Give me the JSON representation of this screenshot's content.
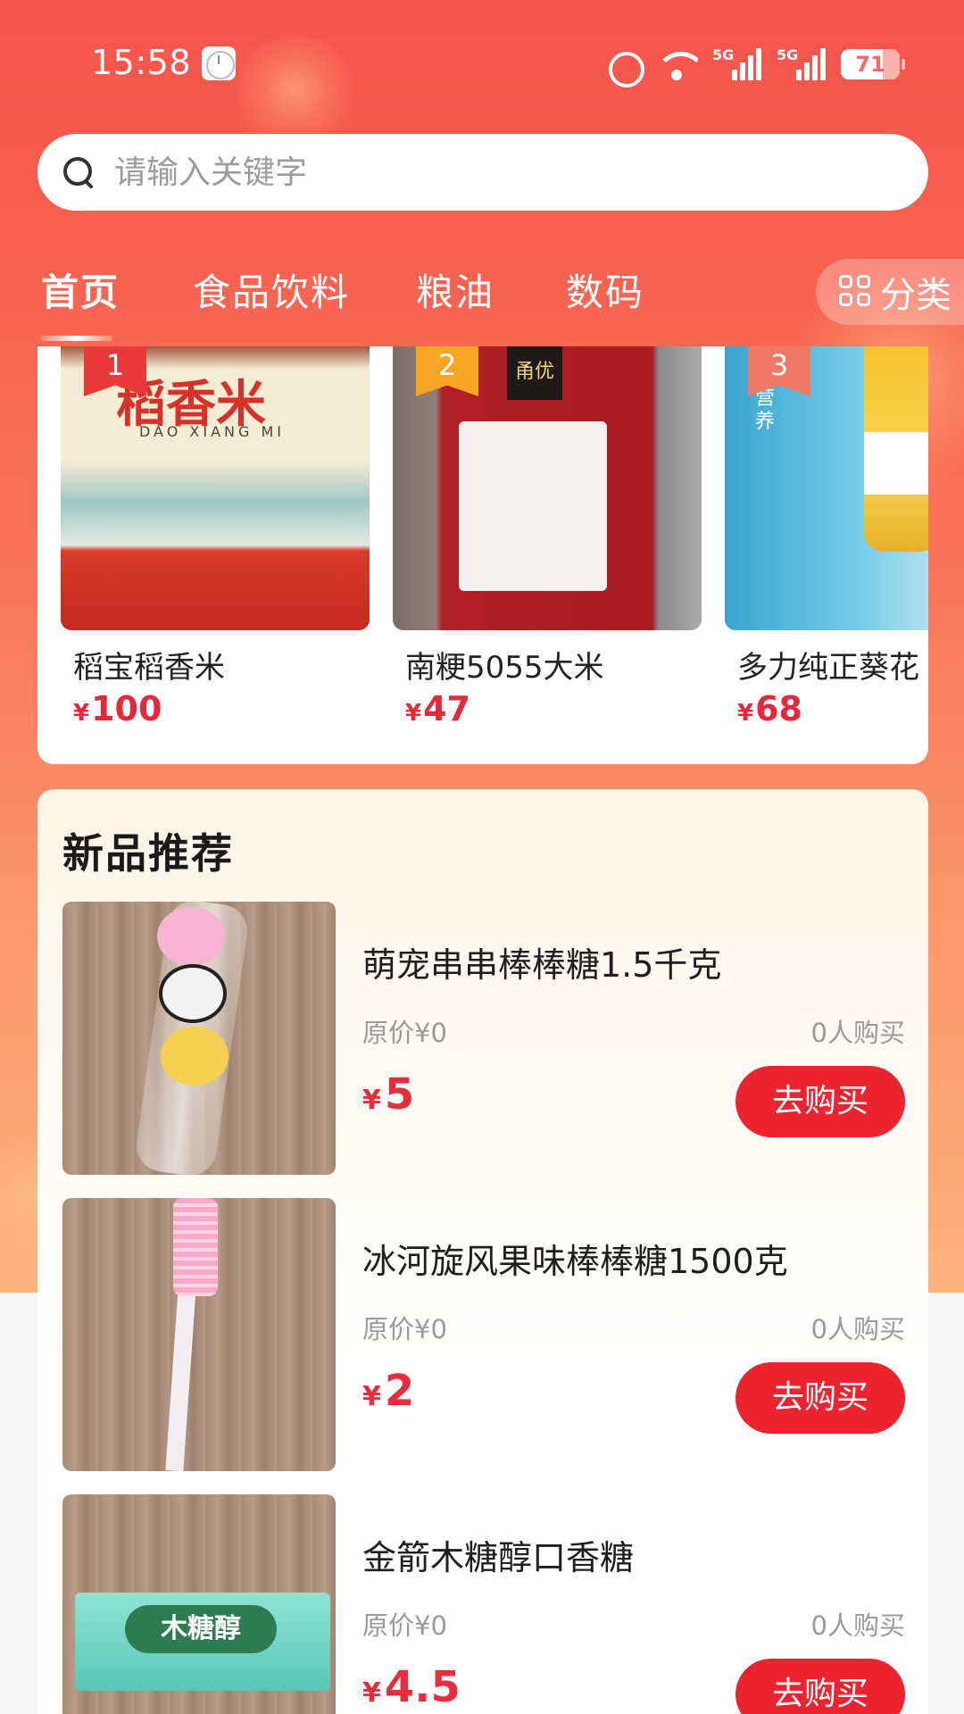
{
  "status_bar": {
    "time": "15:58",
    "battery": "71",
    "battery_level": 0.71,
    "network": [
      "5G",
      "5G"
    ]
  },
  "search": {
    "placeholder": "请输入关键字"
  },
  "tabs": [
    {
      "label": "首页",
      "active": true
    },
    {
      "label": "食品饮料"
    },
    {
      "label": "粮油"
    },
    {
      "label": "数码"
    }
  ],
  "category_button": {
    "label": "分类",
    "icon": "grid-icon"
  },
  "ranking": [
    {
      "rank": "1",
      "name": "稻宝稻香米",
      "currency": "¥",
      "price": "100",
      "package_text": "稻香米",
      "package_sub": "DAO XIANG MI"
    },
    {
      "rank": "2",
      "name": "南粳5055大米",
      "currency": "¥",
      "price": "47",
      "package_text": "甬优"
    },
    {
      "rank": "3",
      "name": "多力纯正葵花",
      "currency": "¥",
      "price": "68",
      "package_text": "营养"
    }
  ],
  "new_products": {
    "title": "新品推荐",
    "items": [
      {
        "name": "萌宠串串棒棒糖1.5千克",
        "original": "原价¥0",
        "buyers": "0人购买",
        "currency": "¥",
        "price": "5",
        "button": "去购买"
      },
      {
        "name": "冰河旋风果味棒棒糖1500克",
        "original": "原价¥0",
        "buyers": "0人购买",
        "currency": "¥",
        "price": "2",
        "button": "去购买"
      },
      {
        "name": "金箭木糖醇口香糖",
        "original": "原价¥0",
        "buyers": "0人购买",
        "currency": "¥",
        "price": "4.5",
        "button": "去购买",
        "package_text": "木糖醇"
      }
    ]
  },
  "colors": {
    "brand_red": "#ed2330",
    "price_red": "#e62d3b",
    "header_top": "#f6534b",
    "header_bottom": "#fdb27a"
  }
}
